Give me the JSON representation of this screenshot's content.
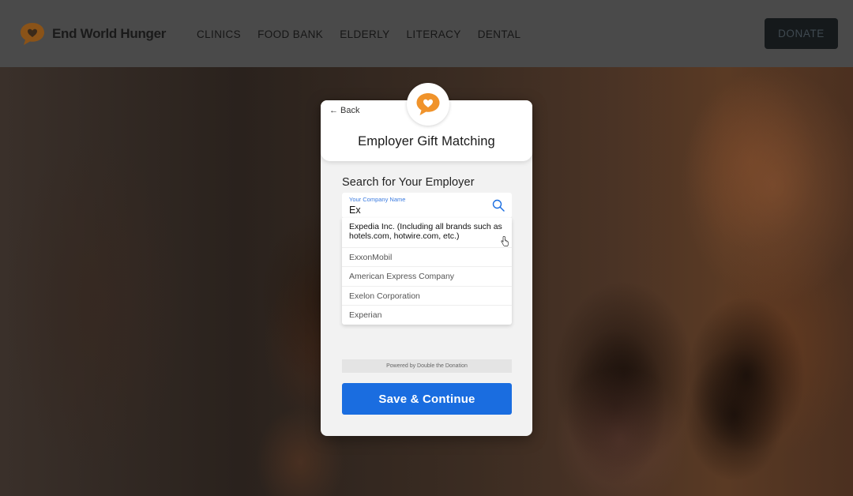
{
  "brand": {
    "name": "End World Hunger",
    "logo_icon": "heart-speech-bubble-icon",
    "color": "#e8902a"
  },
  "nav": {
    "items": [
      "CLINICS",
      "FOOD BANK",
      "ELDERLY",
      "LITERACY",
      "DENTAL"
    ]
  },
  "header": {
    "donate_label": "DONATE"
  },
  "modal": {
    "back_label": "Back",
    "title": "Employer Gift Matching",
    "search_heading": "Search for Your Employer",
    "search": {
      "label": "Your Company Name",
      "value": "Ex"
    },
    "results": [
      "Expedia Inc. (Including all brands such as hotels.com, hotwire.com, etc.)",
      "ExxonMobil",
      "American Express Company",
      "Exelon Corporation",
      "Experian"
    ],
    "powered_by": "Powered by Double the Donation",
    "save_label": "Save & Continue"
  },
  "colors": {
    "accent": "#1a6de0",
    "brand_orange": "#e8902a",
    "header_bg": "#4a4a4a",
    "donate_bg": "#15191b"
  }
}
